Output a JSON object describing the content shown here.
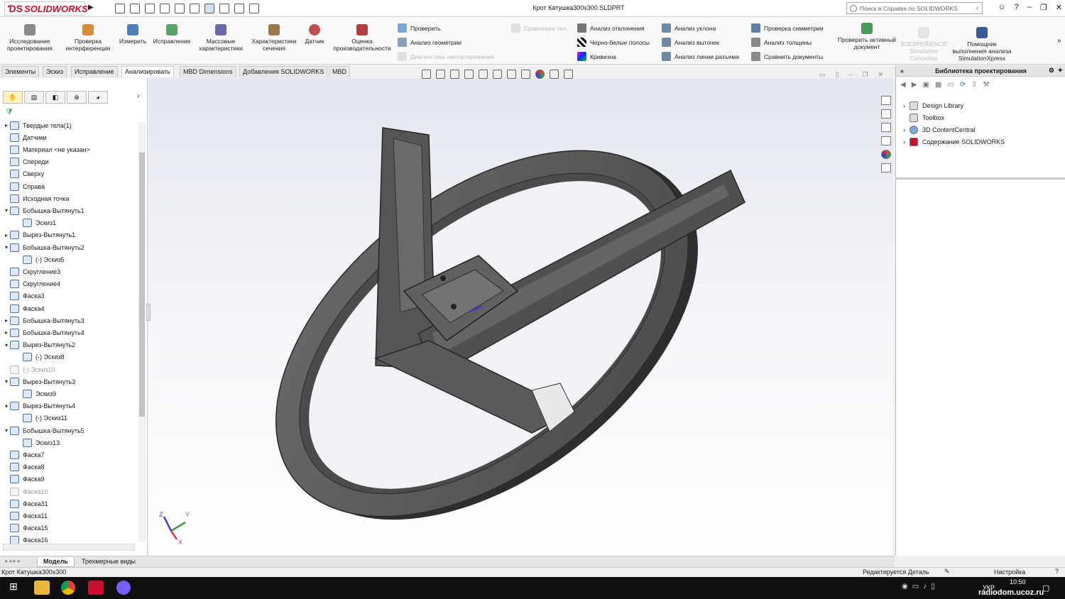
{
  "app": {
    "logo_text": "SOLIDWORKS",
    "document_title": "Крот Катушка300х300.SLDPRT",
    "search_placeholder": "Поиск в Справке по SOLIDWORKS"
  },
  "ribbon": {
    "large_buttons": [
      {
        "id": "design-study",
        "label": "Исследование проектирования"
      },
      {
        "id": "interference",
        "label": "Проверка интерференции"
      },
      {
        "id": "measure",
        "label": "Измерить"
      },
      {
        "id": "repair",
        "label": "Исправление"
      },
      {
        "id": "mass-props",
        "label": "Массовые характеристики"
      },
      {
        "id": "section-props",
        "label": "Характеристики сечения"
      },
      {
        "id": "sensor",
        "label": "Датчик"
      },
      {
        "id": "performance",
        "label": "Оценка производительности"
      }
    ],
    "small_buttons": [
      {
        "id": "check",
        "label": "Проверить",
        "enabled": true
      },
      {
        "id": "geometry-analysis",
        "label": "Анализ геометрии",
        "enabled": true
      },
      {
        "id": "import-diagnostics",
        "label": "Диагностика импортирования",
        "enabled": false
      },
      {
        "id": "compare-bodies",
        "label": "Сравнение тел",
        "enabled": false
      },
      {
        "id": "deviation",
        "label": "Анализ отклонения",
        "enabled": true
      },
      {
        "id": "zebra",
        "label": "Черно-белые полосы",
        "enabled": true
      },
      {
        "id": "curvature",
        "label": "Кривизна",
        "enabled": true
      },
      {
        "id": "draft",
        "label": "Анализ уклона",
        "enabled": true
      },
      {
        "id": "undercut",
        "label": "Анализ выточек",
        "enabled": true
      },
      {
        "id": "parting-line",
        "label": "Анализ линии разъема",
        "enabled": true
      },
      {
        "id": "symmetry",
        "label": "Проверка симметрии",
        "enabled": true
      },
      {
        "id": "thickness",
        "label": "Анализ толщины",
        "enabled": true
      },
      {
        "id": "compare-docs",
        "label": "Сравнить документы",
        "enabled": true
      }
    ],
    "check_active_doc": "Проверить активный документ",
    "experience": "3DEXPERIENCE Simulation Connector",
    "simxpress": "Помощник выполнения анализа SimulationXpress"
  },
  "tabs": [
    "Элементы",
    "Эскиз",
    "Исправление",
    "Анализировать",
    "MBD Dimensions",
    "Добавления SOLIDWORKS",
    "MBD"
  ],
  "active_tab": "Анализировать",
  "tree": [
    {
      "label": "Твердые тела(1)",
      "level": 0,
      "expander": "▸",
      "dim": false
    },
    {
      "label": "Датчики",
      "level": 0,
      "expander": "",
      "dim": false
    },
    {
      "label": "Материал <не указан>",
      "level": 0,
      "expander": "",
      "dim": false
    },
    {
      "label": "Спереди",
      "level": 0,
      "expander": "",
      "dim": false
    },
    {
      "label": "Сверху",
      "level": 0,
      "expander": "",
      "dim": false
    },
    {
      "label": "Справа",
      "level": 0,
      "expander": "",
      "dim": false
    },
    {
      "label": "Исходная точка",
      "level": 0,
      "expander": "",
      "dim": false
    },
    {
      "label": "Бобышка-Вытянуть1",
      "level": 0,
      "expander": "▾",
      "dim": false
    },
    {
      "label": "Эскиз1",
      "level": 1,
      "expander": "",
      "dim": false
    },
    {
      "label": "Вырез-Вытянуть1",
      "level": 0,
      "expander": "▸",
      "dim": false
    },
    {
      "label": "Бобышка-Вытянуть2",
      "level": 0,
      "expander": "▾",
      "dim": false
    },
    {
      "label": "(-) Эскиз5",
      "level": 1,
      "expander": "",
      "dim": false
    },
    {
      "label": "Скругление3",
      "level": 0,
      "expander": "",
      "dim": false
    },
    {
      "label": "Скругление4",
      "level": 0,
      "expander": "",
      "dim": false
    },
    {
      "label": "Фаска3",
      "level": 0,
      "expander": "",
      "dim": false
    },
    {
      "label": "Фаска4",
      "level": 0,
      "expander": "",
      "dim": false
    },
    {
      "label": "Бобышка-Вытянуть3",
      "level": 0,
      "expander": "▸",
      "dim": false
    },
    {
      "label": "Бобышка-Вытянуть4",
      "level": 0,
      "expander": "▸",
      "dim": false
    },
    {
      "label": "Вырез-Вытянуть2",
      "level": 0,
      "expander": "▾",
      "dim": false
    },
    {
      "label": "(-) Эскиз8",
      "level": 1,
      "expander": "",
      "dim": false
    },
    {
      "label": "(-) Эскиз10",
      "level": 0,
      "expander": "",
      "dim": true
    },
    {
      "label": "Вырез-Вытянуть3",
      "level": 0,
      "expander": "▾",
      "dim": false
    },
    {
      "label": "Эскиз9",
      "level": 1,
      "expander": "",
      "dim": false
    },
    {
      "label": "Вырез-Вытянуть4",
      "level": 0,
      "expander": "▾",
      "dim": false
    },
    {
      "label": "(-) Эскиз11",
      "level": 1,
      "expander": "",
      "dim": false
    },
    {
      "label": "Бобышка-Вытянуть5",
      "level": 0,
      "expander": "▾",
      "dim": false
    },
    {
      "label": "Эскиз13",
      "level": 1,
      "expander": "",
      "dim": false
    },
    {
      "label": "Фаска7",
      "level": 0,
      "expander": "",
      "dim": false
    },
    {
      "label": "Фаска8",
      "level": 0,
      "expander": "",
      "dim": false
    },
    {
      "label": "Фаска9",
      "level": 0,
      "expander": "",
      "dim": false
    },
    {
      "label": "Фаска10",
      "level": 0,
      "expander": "",
      "dim": true
    },
    {
      "label": "Фаска31",
      "level": 0,
      "expander": "",
      "dim": false
    },
    {
      "label": "Фаска11",
      "level": 0,
      "expander": "",
      "dim": false
    },
    {
      "label": "Фаска15",
      "level": 0,
      "expander": "",
      "dim": false
    },
    {
      "label": "Фаска16",
      "level": 0,
      "expander": "",
      "dim": false
    }
  ],
  "taskpane": {
    "title": "Библиотека проектирования",
    "items": [
      "Design Library",
      "Toolbox",
      "3D ContentCentral",
      "Содержание SOLIDWORKS"
    ]
  },
  "bottom_tabs": [
    "Модель",
    "Трехмерные виды"
  ],
  "status": {
    "left": "Крот Катушка300х300",
    "editing": "Редактируется Деталь",
    "settings": "Настройка"
  },
  "taskbar": {
    "lang": "УКР",
    "time": "10:50",
    "watermark": "radiodom.ucoz.ru"
  },
  "triad": {
    "x": "X",
    "y": "Y",
    "z": "Z"
  },
  "colors": {
    "brand": "#c8102e",
    "part": "#5f5f5f",
    "part_dark": "#3a3a3a",
    "taskbar": "#101010"
  }
}
